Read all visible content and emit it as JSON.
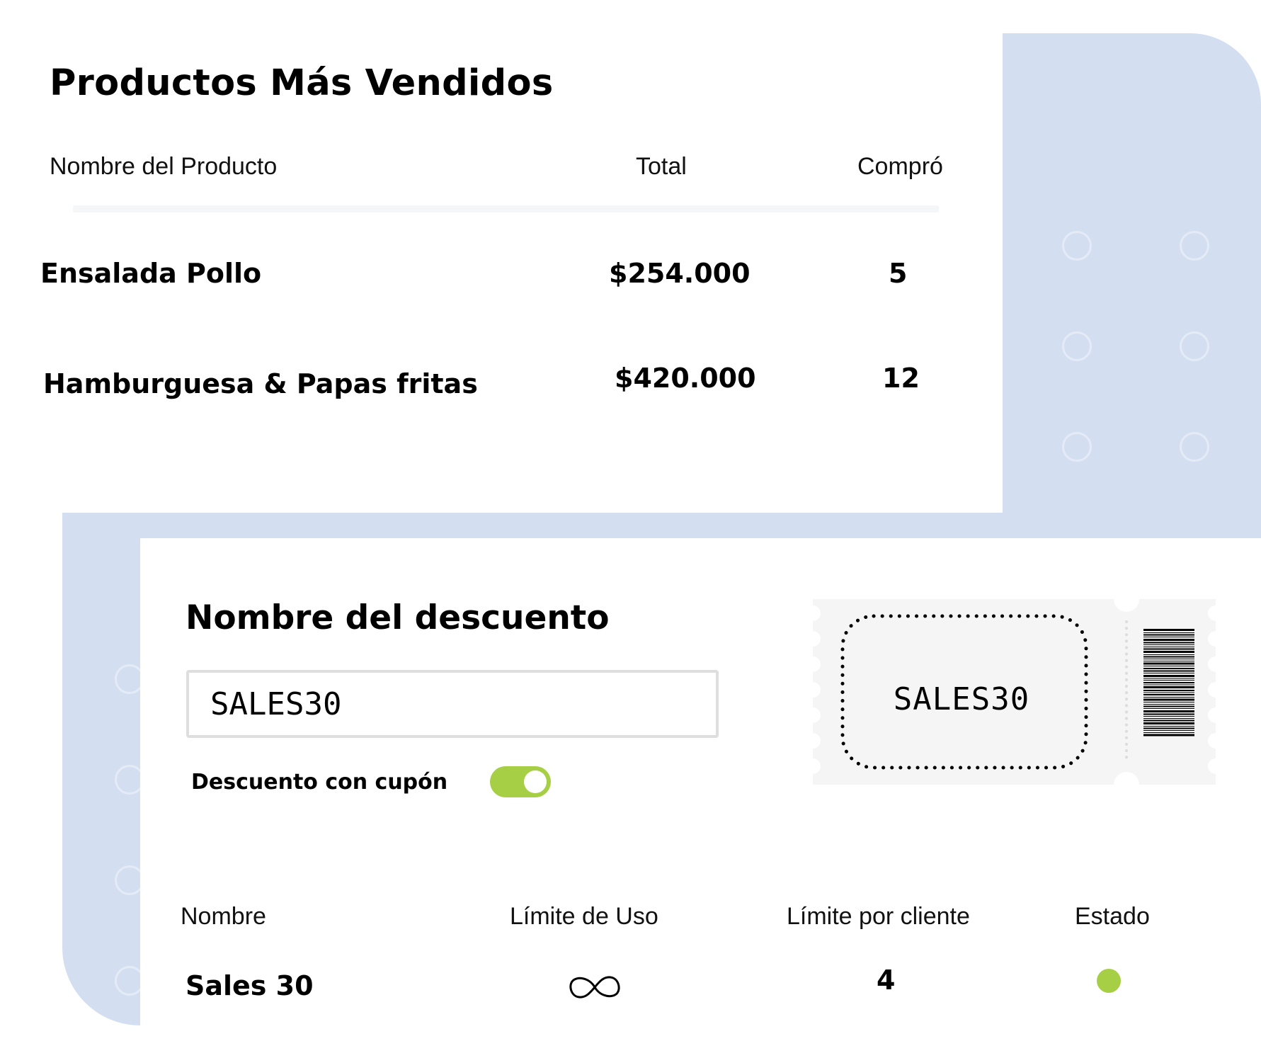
{
  "top_products": {
    "title": "Productos Más Vendidos",
    "columns": {
      "name": "Nombre del Producto",
      "total": "Total",
      "bought": "Compró"
    },
    "rows": [
      {
        "name": "Ensalada Pollo",
        "total": "$254.000",
        "bought": "5"
      },
      {
        "name": "Hamburguesa & Papas fritas",
        "total": "$420.000",
        "bought": "12"
      }
    ]
  },
  "discount": {
    "title": "Nombre del descuento",
    "code_value": "SALES30",
    "coupon_label": "Descuento con cupón",
    "coupon_enabled": true,
    "ticket_code": "SALES30",
    "table": {
      "columns": {
        "name": "Nombre",
        "usage_limit": "Límite de Uso",
        "client_limit": "Límite por cliente",
        "state": "Estado"
      },
      "row": {
        "name": "Sales 30",
        "usage_limit_icon": "infinity-icon",
        "client_limit": "4",
        "state_icon": "status-dot"
      }
    }
  },
  "colors": {
    "accent_green": "#a6cf45",
    "background_blue": "#d3dff0",
    "ticket_gray": "#f4f5f4"
  }
}
